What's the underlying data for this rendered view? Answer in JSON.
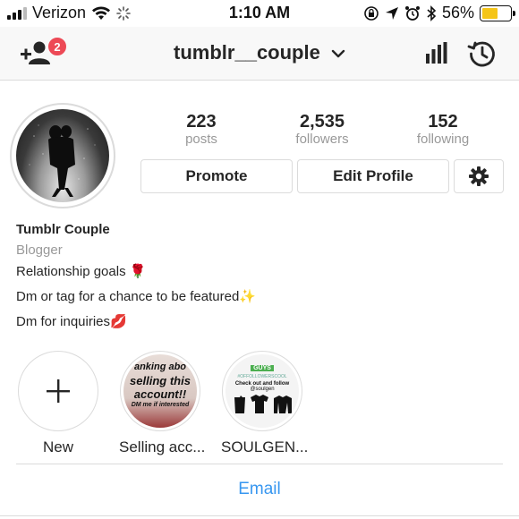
{
  "status_bar": {
    "carrier": "Verizon",
    "time": "1:10 AM",
    "battery_percent_text": "56%",
    "battery_level": 0.56,
    "battery_color": "#f5c518"
  },
  "nav": {
    "username": "tumblr__couple",
    "notification_count": "2",
    "icons": [
      "add-user-icon",
      "chevron-down-icon",
      "insights-bar-chart-icon",
      "history-icon"
    ]
  },
  "profile": {
    "posts_count": "223",
    "posts_label": "posts",
    "followers_count": "2,535",
    "followers_label": "followers",
    "following_count": "152",
    "following_label": "following",
    "promote_label": "Promote",
    "edit_profile_label": "Edit Profile"
  },
  "bio": {
    "name": "Tumblr Couple",
    "category": "Blogger",
    "line1": "Relationship goals 🌹",
    "line2": "Dm or tag for a chance to be featured✨",
    "line3": "Dm for inquiries💋"
  },
  "highlights": [
    {
      "label": "New"
    },
    {
      "label": "Selling acc...",
      "cover_text": [
        "anking abo",
        "selling this",
        "account!!",
        "DM me if interested"
      ]
    },
    {
      "label": "SOULGEN...",
      "cover_text": [
        "GUYS",
        "#OFFOLLOWERSCOOL",
        "Check out and follow",
        "@soulgen"
      ]
    }
  ],
  "contact": {
    "email_label": "Email"
  },
  "colors": {
    "badge": "#ed4956",
    "link": "#3897f0",
    "muted": "#999999",
    "border": "#dbdbdb"
  }
}
